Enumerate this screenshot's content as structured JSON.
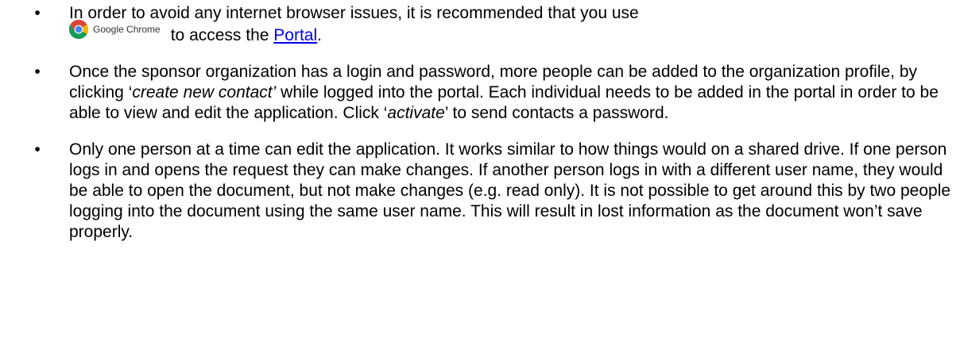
{
  "bullets": [
    {
      "line1": "In order to avoid any internet browser issues, it is recommended that you use",
      "chrome_label": "Google Chrome",
      "chrome_icon": "google-chrome-logo-icon",
      "line2_prefix": "to access the ",
      "link_text": "Portal",
      "line2_suffix": "."
    },
    {
      "p1": "Once the sponsor organization has a login and password, more people can be added to the organization profile, by clicking ",
      "q1_open": "‘",
      "em1": "create new contact’",
      "p2": " while logged into the portal. Each individual needs to be added in the portal in order to be able to view and edit the application.  Click ",
      "q2_open": "‘",
      "em2": "activate",
      "p3": "’ to send contacts a password."
    },
    {
      "text": "Only one person at a time can edit the application.  It works similar to how things would on a shared drive.  If one person logs in and opens the request they can make changes.  If another person logs in with a different user name, they would be able to open the document, but not make changes (e.g. read only).  It is not possible to get around this by two people logging into the document using the same user name.  This will result in lost information as the document won’t save properly."
    }
  ],
  "bullet_char": "•",
  "colors": {
    "link": "#0000ee",
    "text": "#000000"
  }
}
